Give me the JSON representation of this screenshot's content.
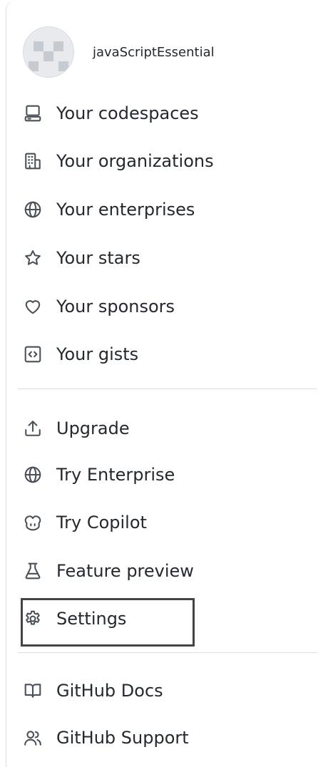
{
  "user": {
    "username": "javaScriptEssential"
  },
  "menu_group_1": [
    {
      "label": "Your codespaces",
      "icon": "codespaces-icon"
    },
    {
      "label": "Your organizations",
      "icon": "organization-icon"
    },
    {
      "label": "Your enterprises",
      "icon": "globe-icon"
    },
    {
      "label": "Your stars",
      "icon": "star-icon"
    },
    {
      "label": "Your sponsors",
      "icon": "heart-icon"
    },
    {
      "label": "Your gists",
      "icon": "code-square-icon"
    }
  ],
  "menu_group_2": [
    {
      "label": "Upgrade",
      "icon": "upload-icon"
    },
    {
      "label": "Try Enterprise",
      "icon": "globe-icon"
    },
    {
      "label": "Try Copilot",
      "icon": "copilot-icon"
    },
    {
      "label": "Feature preview",
      "icon": "beaker-icon"
    },
    {
      "label": "Settings",
      "icon": "gear-icon"
    }
  ],
  "menu_group_3": [
    {
      "label": "GitHub Docs",
      "icon": "book-icon"
    },
    {
      "label": "GitHub Support",
      "icon": "people-icon"
    }
  ],
  "colors": {
    "text": "#24292f",
    "icon": "#4a5057",
    "divider": "#d8dee4",
    "highlight_border": "#444444"
  }
}
